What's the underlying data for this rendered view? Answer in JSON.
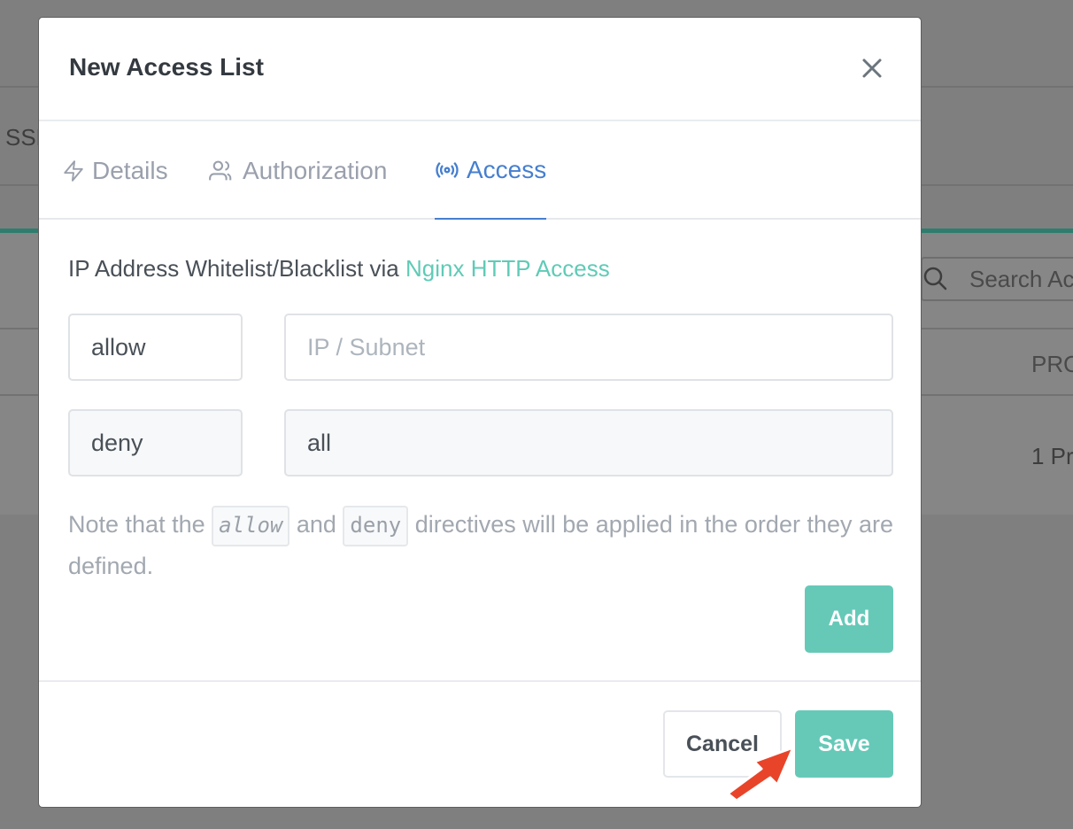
{
  "background": {
    "ssl_fragment": "SSL",
    "search_placeholder": "Search Acc",
    "column_header": "PRO",
    "cell_value": "1 Pr"
  },
  "modal": {
    "title": "New Access List",
    "close_icon": "close-icon",
    "tabs": [
      {
        "label": "Details",
        "icon": "lightning-icon",
        "active": false
      },
      {
        "label": "Authorization",
        "icon": "users-icon",
        "active": false
      },
      {
        "label": "Access",
        "icon": "broadcast-icon",
        "active": true
      }
    ],
    "intro_text": "IP Address Whitelist/Blacklist via ",
    "intro_link": "Nginx HTTP Access",
    "rules": [
      {
        "directive": "allow",
        "address_value": "",
        "address_placeholder": "IP / Subnet"
      },
      {
        "directive": "deny",
        "address_value": "all",
        "address_placeholder": ""
      }
    ],
    "note": {
      "part1": "Note that the ",
      "code1": "allow",
      "part2": " and ",
      "code2": "deny",
      "part3": " directives will be applied in the order they are defined."
    },
    "add_label": "Add",
    "cancel_label": "Cancel",
    "save_label": "Save"
  },
  "colors": {
    "accent_teal": "#66c9b8",
    "active_tab_blue": "#467fcf",
    "annotation_arrow": "#e8442a"
  }
}
